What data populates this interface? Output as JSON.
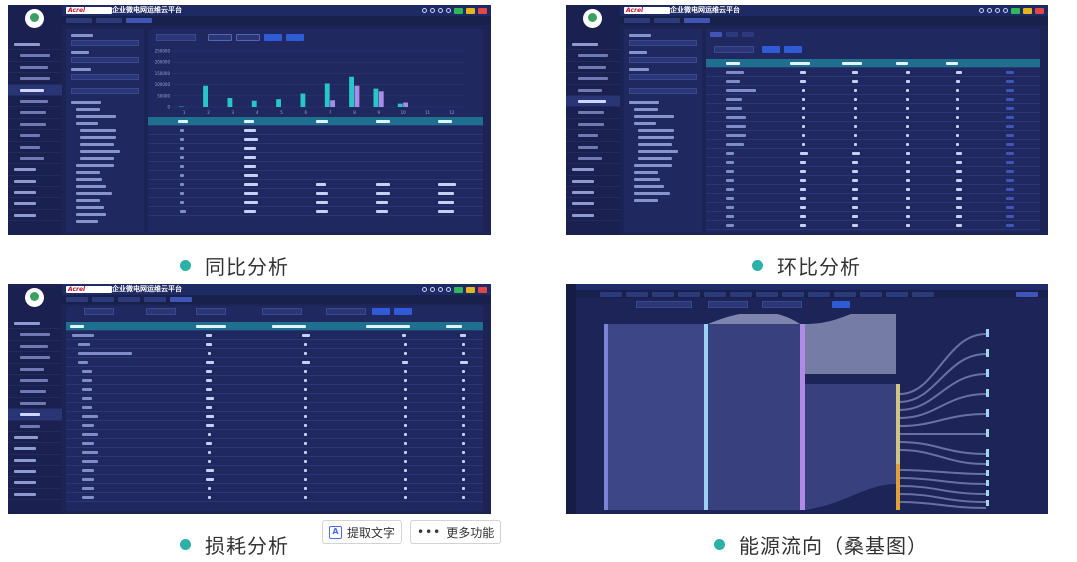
{
  "app_title": "企业微电网运维云平台",
  "logo_text": "Acrel",
  "captions": {
    "panel1": "同比分析",
    "panel2": "环比分析",
    "panel3": "损耗分析",
    "panel4": "能源流向（桑基图）"
  },
  "floating_toolbar": {
    "extract_text": "提取文字",
    "more_features": "更多功能"
  },
  "colors": {
    "panel_bg": "#1b2454",
    "accent_cyan": "#27c6c7",
    "accent_purple": "#a78de8",
    "caption_dot": "#2bb1a6",
    "header_teal": "#1f6f8e"
  },
  "chart_data": {
    "type": "bar",
    "categories": [
      "1",
      "2",
      "3",
      "4",
      "5",
      "6",
      "7",
      "8",
      "9",
      "10",
      "11",
      "12"
    ],
    "series": [
      {
        "values": [
          2000,
          95000,
          40000,
          28000,
          35000,
          60000,
          105000,
          135000,
          82000,
          15000,
          0,
          0
        ]
      },
      {
        "values": [
          0,
          0,
          0,
          0,
          0,
          0,
          30000,
          95000,
          70000,
          20000,
          0,
          0
        ]
      }
    ],
    "ylim": [
      0,
      250000
    ]
  }
}
